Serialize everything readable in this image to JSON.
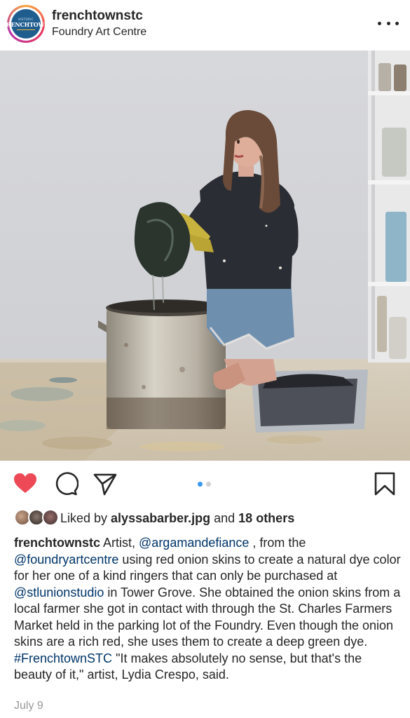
{
  "header": {
    "username": "frenchtownstc",
    "location": "Foundry Art Centre",
    "avatar": {
      "logo_top": "HISTORIC",
      "logo_main": "FRENCHTOWN"
    }
  },
  "carousel": {
    "count": 2,
    "active": 1
  },
  "likes": {
    "prefix": "Liked by ",
    "user": "alyssabarber.jpg",
    "and": " and ",
    "others": "18 others"
  },
  "caption": {
    "username": "frenchtownstc",
    "t1": " Artist, ",
    "mention1": "@argamandefiance",
    "t2": " , from the ",
    "mention2": "@foundryartcentre",
    "t3": " using red onion skins to create a natural dye color for her one of a kind ringers that can only be purchased at ",
    "mention3": "@stlunionstudio",
    "t4": " in Tower Grove. She obtained the onion skins from a local farmer she got in contact with through the St. Charles Farmers Market held in the parking lot of the Foundry. Even though the onion skins are a rich red, she uses them to create a deep green dye. ",
    "hashtag": "#FrenchtownSTC",
    "t5": " \"It makes absolutely no sense, but that's the beauty of it,\" artist, Lydia Crespo, said."
  },
  "date": "July 9",
  "icons": {
    "like": "heart-filled-icon",
    "comment": "comment-bubble-icon",
    "share": "paper-plane-icon",
    "save": "bookmark-icon",
    "more": "ellipsis-icon"
  },
  "colors": {
    "like_red": "#ed4956",
    "link_blue": "#003569",
    "active_dot": "#3897f0",
    "avatar_blue": "#1f5d8f"
  }
}
